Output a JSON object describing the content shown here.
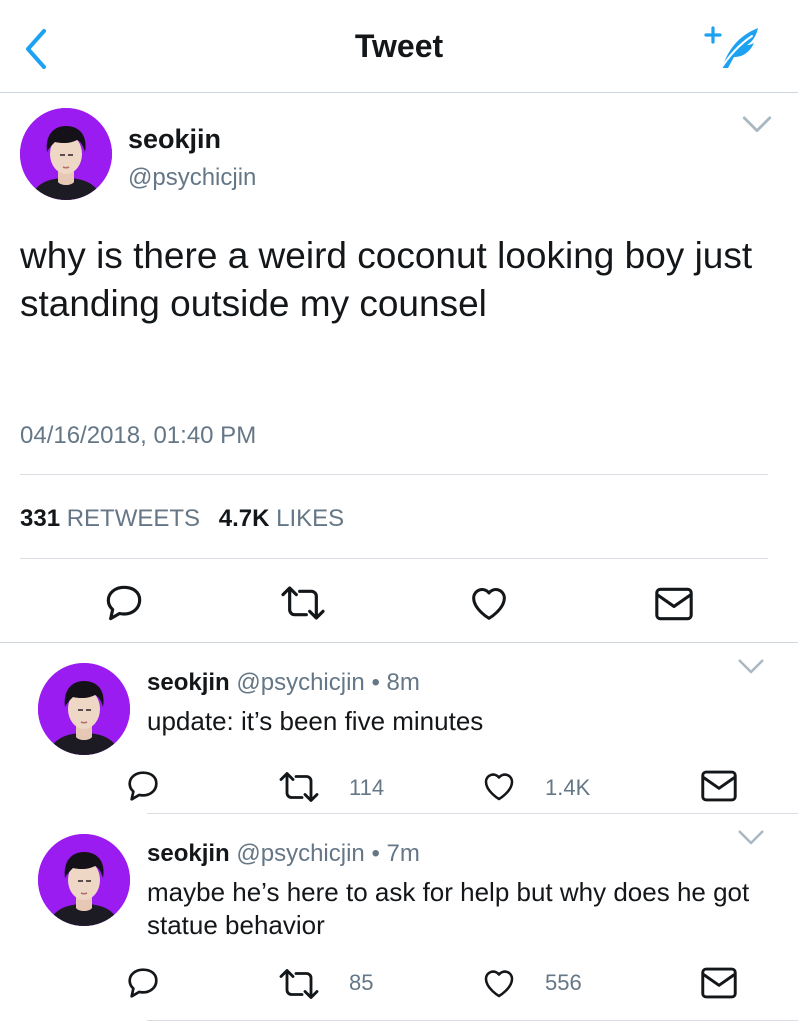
{
  "colors": {
    "accent": "#1da1f2",
    "text": "#14171a",
    "secondary": "#657786",
    "avatar_bg": "#9b1cf0"
  },
  "nav": {
    "title": "Tweet",
    "back_icon": "chevron-left-icon",
    "compose_icon": "compose-feather-icon"
  },
  "main_tweet": {
    "name": "seokjin",
    "handle": "@psychicjin",
    "text": "why is there a weird coconut looking boy just standing outside my counsel",
    "timestamp": "04/16/2018, 01:40 PM",
    "retweets": "331",
    "retweets_label": "RETWEETS",
    "likes": "4.7K",
    "likes_label": "LIKES"
  },
  "replies": [
    {
      "name": "seokjin",
      "handle": "@psychicjin",
      "time": "8m",
      "text": "update: it’s been five minutes",
      "retweets": "114",
      "likes": "1.4K"
    },
    {
      "name": "seokjin",
      "handle": "@psychicjin",
      "time": "7m",
      "text": "maybe he’s here to ask for help but why does he got statue behavior",
      "retweets": "85",
      "likes": "556"
    }
  ]
}
